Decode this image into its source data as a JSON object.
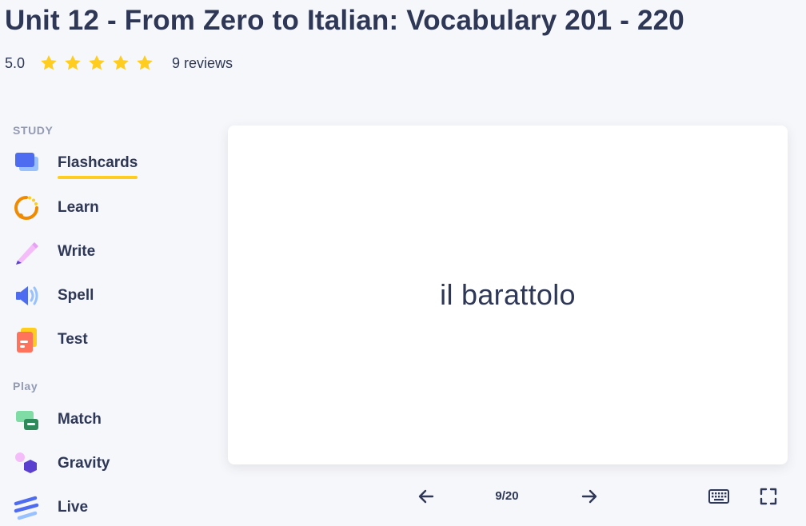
{
  "header": {
    "title": "Unit 12 - From Zero to Italian: Vocabulary 201 - 220",
    "rating": "5.0",
    "stars": 5,
    "reviews": "9 reviews"
  },
  "sidebar": {
    "study_label": "STUDY",
    "study_items": [
      {
        "label": "Flashcards",
        "icon": "flashcards-icon",
        "active": true
      },
      {
        "label": "Learn",
        "icon": "learn-icon"
      },
      {
        "label": "Write",
        "icon": "write-icon"
      },
      {
        "label": "Spell",
        "icon": "spell-icon"
      },
      {
        "label": "Test",
        "icon": "test-icon"
      }
    ],
    "play_label": "Play",
    "play_items": [
      {
        "label": "Match",
        "icon": "match-icon"
      },
      {
        "label": "Gravity",
        "icon": "gravity-icon"
      },
      {
        "label": "Live",
        "icon": "live-icon"
      }
    ]
  },
  "flashcard": {
    "term": "il barattolo"
  },
  "controls": {
    "counter": "9/20",
    "prev_icon": "arrow-left-icon",
    "next_icon": "arrow-right-icon",
    "keyboard_icon": "keyboard-icon",
    "fullscreen_icon": "fullscreen-icon"
  },
  "colors": {
    "text": "#2e3856",
    "muted": "#939bb4",
    "star": "#ffcd1f",
    "active_underline": "#ffcd1f",
    "background": "#f6f7fb"
  }
}
